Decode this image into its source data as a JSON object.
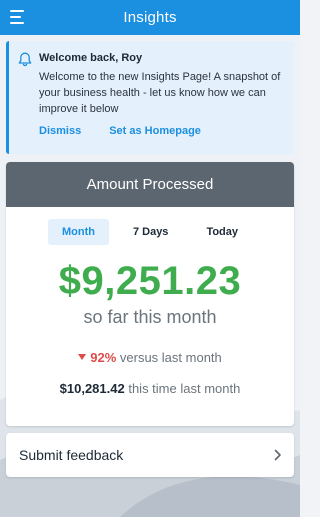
{
  "header": {
    "title": "Insights",
    "menu_icon": "hamburger-menu-icon"
  },
  "banner": {
    "icon": "bell-icon",
    "title": "Welcome back, Roy",
    "body": "Welcome to the new Insights Page! A snapshot of your business health - let us know how we can improve it below",
    "dismiss_label": "Dismiss",
    "homepage_label": "Set as Homepage"
  },
  "card": {
    "title": "Amount Processed",
    "tabs": [
      {
        "label": "Month",
        "active": true
      },
      {
        "label": "7 Days",
        "active": false
      },
      {
        "label": "Today",
        "active": false
      }
    ],
    "amount": "$9,251.23",
    "amount_caption": "so far this month",
    "change_pct": "92%",
    "change_text": "versus last month",
    "last_amount": "$10,281.42",
    "last_text": "this time last month"
  },
  "feedback": {
    "label": "Submit feedback",
    "icon": "chevron-right-icon"
  },
  "colors": {
    "header": "#1b8fe0",
    "accent": "#1b8fe0",
    "amount": "#3fad4e",
    "decline": "#e04b4b",
    "card_header": "#5c6670"
  }
}
